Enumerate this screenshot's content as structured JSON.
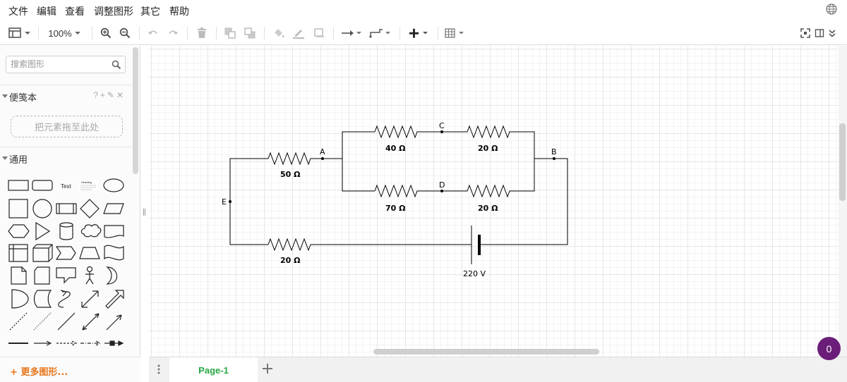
{
  "menu": [
    "文件",
    "编辑",
    "查看",
    "调整图形",
    "其它",
    "帮助"
  ],
  "toolbar": {
    "zoom": "100%"
  },
  "sidebar": {
    "search_placeholder": "搜索图形",
    "scratchpad_title": "便笺本",
    "scratchpad_actions": "?+✎✕",
    "dropzone_text": "把元素拖至此处",
    "general_title": "通用",
    "shape_text_label": "Text",
    "shape_heading_label": "Heading",
    "more_shapes": "+ 更多图形..."
  },
  "diagram": {
    "labels": {
      "A": "A",
      "B": "B",
      "C": "C",
      "D": "D",
      "E": "E",
      "r_50": "50 Ω",
      "r_40": "40 Ω",
      "r_20_top": "20 Ω",
      "r_70": "70 Ω",
      "r_20_mid": "20 Ω",
      "r_20_bottom": "20 Ω",
      "voltage": "220 V"
    }
  },
  "pages": {
    "current": "Page-1"
  },
  "badge_count": "0"
}
